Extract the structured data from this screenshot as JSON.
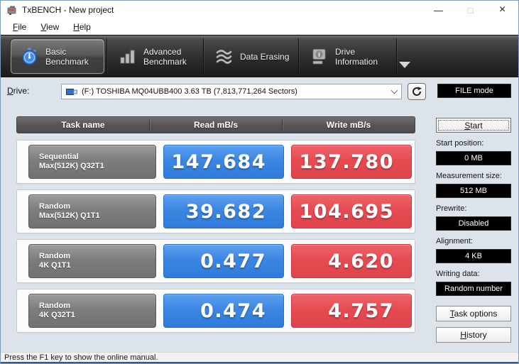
{
  "window": {
    "title": "TxBENCH - New project",
    "controls": {
      "minimize": "—",
      "maximize": "□",
      "close": "×"
    }
  },
  "menu": {
    "items": [
      {
        "u": "F",
        "rest": "ile"
      },
      {
        "u": "V",
        "rest": "iew"
      },
      {
        "u": "H",
        "rest": "elp"
      }
    ]
  },
  "toolbar": {
    "tabs": [
      {
        "line1": "Basic",
        "line2": "Benchmark",
        "icon": "stopwatch-icon",
        "selected": true
      },
      {
        "line1": "Advanced",
        "line2": "Benchmark",
        "icon": "bar-chart-icon",
        "selected": false
      },
      {
        "line1": "Data Erasing",
        "line2": "",
        "icon": "erase-waves-icon",
        "selected": false
      },
      {
        "line1": "Drive",
        "line2": "Information",
        "icon": "drive-info-icon",
        "selected": false
      }
    ]
  },
  "drive": {
    "label_u": "D",
    "label_rest": "rive:",
    "value": "(F:) TOSHIBA MQ04UBB400  3.63 TB (7,813,771,264 Sectors)",
    "file_mode_label": "FILE mode"
  },
  "table": {
    "headers": [
      "Task name",
      "Read mB/s",
      "Write mB/s"
    ],
    "rows": [
      {
        "task_line1": "Sequential",
        "task_line2": "Max(512K) Q32T1",
        "read": "147.684",
        "write": "137.780"
      },
      {
        "task_line1": "Random",
        "task_line2": "Max(512K) Q1T1",
        "read": "39.682",
        "write": "104.695"
      },
      {
        "task_line1": "Random",
        "task_line2": "4K Q1T1",
        "read": "0.477",
        "write": "4.620"
      },
      {
        "task_line1": "Random",
        "task_line2": "4K Q32T1",
        "read": "0.474",
        "write": "4.757"
      }
    ]
  },
  "panel": {
    "start": {
      "u": "S",
      "rest": "tart"
    },
    "fields": [
      {
        "label": "Start position:",
        "value": "0 MB"
      },
      {
        "label": "Measurement size:",
        "value": "512 MB"
      },
      {
        "label": "Prewrite:",
        "value": "Disabled"
      },
      {
        "label": "Alignment:",
        "value": "4 KB"
      },
      {
        "label": "Writing data:",
        "value": "Random number"
      }
    ],
    "task_options": {
      "u": "T",
      "rest": "ask options"
    },
    "history": {
      "u": "H",
      "rest": "istory"
    }
  },
  "statusbar": {
    "text": "Press the F1 key to show the online manual."
  },
  "colors": {
    "accent_blue": "#3c86e2",
    "accent_red": "#e64b52",
    "task_gray": "#7d7d7d",
    "toolbar_dark": "#2b2b2b"
  }
}
